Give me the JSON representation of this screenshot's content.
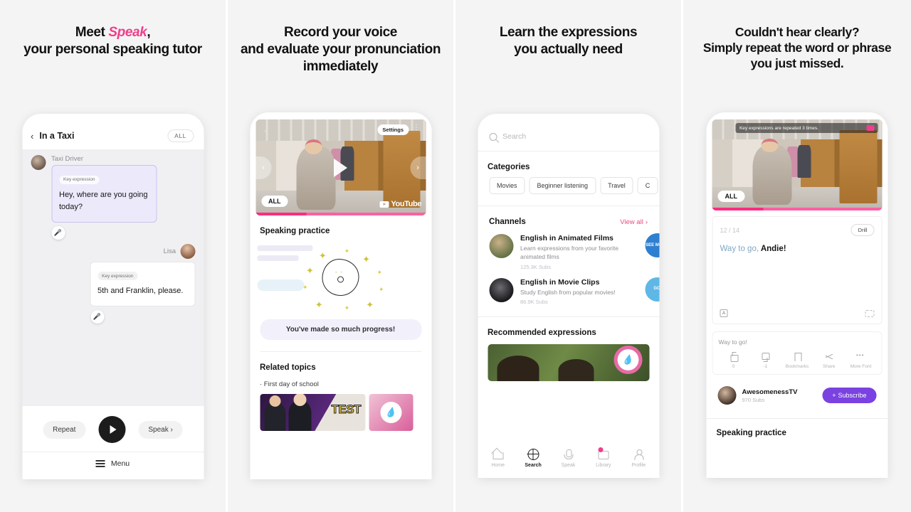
{
  "panels": [
    {
      "headline_line1_pre": "Meet ",
      "headline_accent": "Speak",
      "headline_line1_post": ",",
      "headline_line2": "your personal speaking tutor",
      "app": {
        "back_icon": "chevron-left-icon",
        "title": "In a Taxi",
        "all_button": "ALL",
        "messages": [
          {
            "sender": "Taxi Driver",
            "tag": "Key expression",
            "text": "Hey, where are you going today?",
            "side": "left",
            "mic_icon": "microphone-icon"
          },
          {
            "sender": "Lisa",
            "tag": "Key expression",
            "text": "5th and Franklin, please.",
            "side": "right",
            "mic_icon": "microphone-icon"
          }
        ],
        "controls": {
          "repeat": "Repeat",
          "play_icon": "play-icon",
          "speak": "Speak",
          "speak_chevron": "›"
        },
        "menu": "Menu"
      }
    },
    {
      "headline_line1": "Record your voice",
      "headline_line2": "and evaluate your pronunciation",
      "headline_line3": "immediately",
      "app": {
        "video": {
          "settings_label": "Settings",
          "kebab_icon": "kebab-menu-icon",
          "play_icon": "play-icon",
          "all_badge": "ALL",
          "youtube_label": "YouTube",
          "prev_icon": "chevron-left-icon",
          "next_icon": "chevron-right-icon",
          "collapse_icon": "chevron-down-icon"
        },
        "practice_title": "Speaking practice",
        "progress_message": "You've made so much progress!",
        "related_title": "Related topics",
        "related_item": "· First day of school",
        "thumb_text": "TEST"
      }
    },
    {
      "headline_line1": "Learn the expressions",
      "headline_line2": "you actually need",
      "app": {
        "search_placeholder": "Search",
        "search_icon": "search-icon",
        "categories_title": "Categories",
        "categories": [
          "Movies",
          "Beginner listening",
          "Travel",
          "C"
        ],
        "channels_title": "Channels",
        "view_all": "View all",
        "channels": [
          {
            "name": "English in Animated Films",
            "desc": "Learn expressions from your favorite animated films",
            "subs": "125.3K Subs",
            "badge": "SEE MORE"
          },
          {
            "name": "English in Movie Clips",
            "desc": "Study English from popular movies!",
            "subs": "86.9K Subs",
            "badge": "GO"
          }
        ],
        "recommended_title": "Recommended expressions",
        "tabs": [
          {
            "label": "Home",
            "icon": "home-icon",
            "active": false
          },
          {
            "label": "Search",
            "icon": "globe-icon",
            "active": true
          },
          {
            "label": "Speak",
            "icon": "microphone-icon",
            "active": false
          },
          {
            "label": "Library",
            "icon": "library-icon",
            "active": false
          },
          {
            "label": "Profile",
            "icon": "user-icon",
            "active": false
          }
        ]
      }
    },
    {
      "headline_line1": "Couldn't hear clearly?",
      "headline_line2": "Simply repeat the word or phrase",
      "headline_line3": "you just missed.",
      "app": {
        "tip_text": "Key expressions are repeated 3 times.",
        "all_badge": "ALL",
        "caption": {
          "index": "12",
          "total": "/ 14",
          "drill_label": "Drill",
          "text_dim": "Way to go,",
          "text_hi": " Andie!",
          "font_icon": "text-size-icon",
          "loop_icon": "loop-icon"
        },
        "social": {
          "title": "Way to go!",
          "actions": [
            {
              "label": "0",
              "icon": "thumbs-up-icon"
            },
            {
              "label": "-1",
              "icon": "thumbs-down-icon"
            },
            {
              "label": "Bookmarks",
              "icon": "bookmark-icon"
            },
            {
              "label": "Share",
              "icon": "share-icon"
            },
            {
              "label": "More Font",
              "icon": "more-icon"
            }
          ]
        },
        "channel": {
          "name": "AwesomenessTV",
          "subs": "970 Subs",
          "subscribe": "Subscribe",
          "plus_icon": "plus-icon"
        },
        "footer_title": "Speaking practice"
      }
    }
  ],
  "colors": {
    "accent_pink": "#ef3e8c",
    "purple": "#7a42e0",
    "panel_bg": "#f4f4f4"
  }
}
